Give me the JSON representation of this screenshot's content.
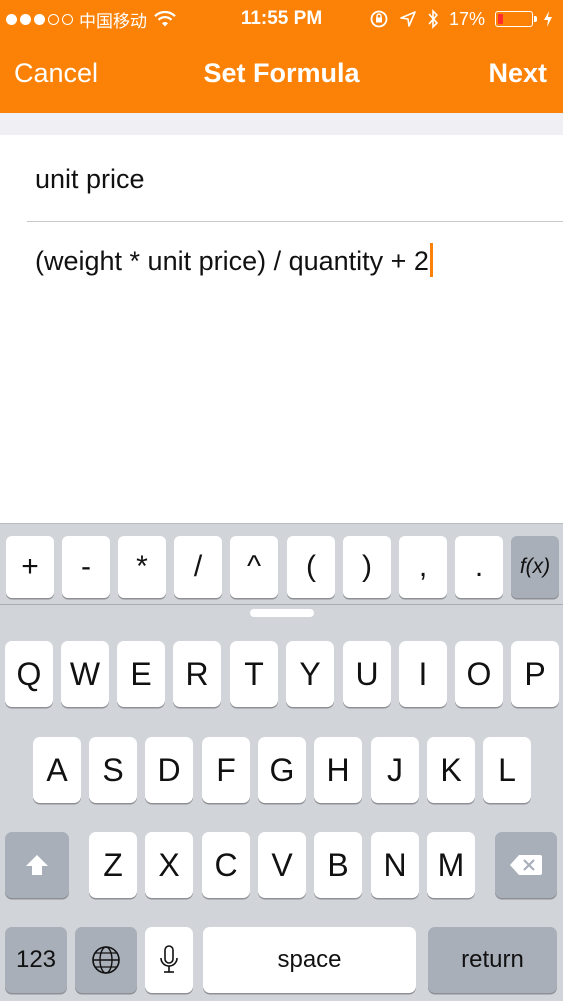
{
  "status_bar": {
    "carrier": "中国移动",
    "time": "11:55 PM",
    "battery_percent": "17%",
    "battery_level": 0.17,
    "signal_bars_filled": 3,
    "signal_bars_total": 5
  },
  "nav": {
    "cancel_label": "Cancel",
    "title": "Set Formula",
    "next_label": "Next"
  },
  "form": {
    "name_value": "unit price",
    "formula_value": "(weight * unit price) / quantity + 2"
  },
  "accessory_keys": [
    "+",
    "-",
    "*",
    "/",
    "^",
    "(",
    ")",
    ",",
    ".",
    "f(x)"
  ],
  "keyboard": {
    "row1": [
      "Q",
      "W",
      "E",
      "R",
      "T",
      "Y",
      "U",
      "I",
      "O",
      "P"
    ],
    "row2": [
      "A",
      "S",
      "D",
      "F",
      "G",
      "H",
      "J",
      "K",
      "L"
    ],
    "row3": [
      "Z",
      "X",
      "C",
      "V",
      "B",
      "N",
      "M"
    ],
    "numbers_label": "123",
    "space_label": "space",
    "return_label": "return"
  },
  "colors": {
    "accent": "#fb8206",
    "keyboard_bg": "#d1d4d9",
    "key_bg": "#ffffff",
    "dark_key_bg": "#a9afb9",
    "battery_low": "#ff2d2d"
  },
  "icons": {
    "wifi": "wifi-icon",
    "lock_rotation": "rotation-lock-icon",
    "location": "location-arrow-icon",
    "bluetooth": "bluetooth-icon",
    "battery": "battery-icon",
    "charging": "bolt-icon",
    "shift": "shift-arrow-icon",
    "delete": "backspace-icon",
    "globe": "globe-icon",
    "microphone": "microphone-icon"
  }
}
